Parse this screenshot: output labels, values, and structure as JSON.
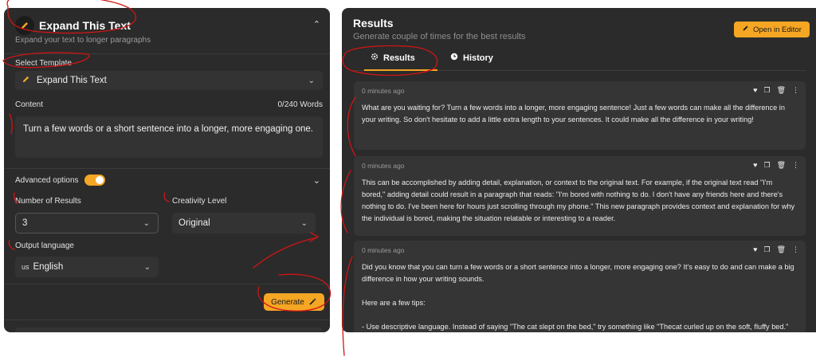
{
  "left": {
    "title": "Expand This Text",
    "subtitle": "Expand your text to longer paragraphs",
    "template_label": "Select Template",
    "template_value": "Expand This Text",
    "content_label": "Content",
    "word_count": "0/240 Words",
    "content_value": "Turn a few words or a short sentence into a longer, more engaging one.",
    "advanced_label": "Advanced options",
    "results_label": "Number of Results",
    "results_value": "3",
    "creativity_label": "Creativity Level",
    "creativity_value": "Original",
    "language_label": "Output language",
    "language_flag": "us",
    "language_value": "English",
    "generate_label": "Generate"
  },
  "right": {
    "title": "Results",
    "subtitle": "Generate couple of times for the best results",
    "open_editor_label": "Open in Editor",
    "tabs": [
      {
        "label": "Results",
        "active": true
      },
      {
        "label": "History",
        "active": false
      }
    ],
    "results": [
      {
        "time": "0 minutes ago",
        "text": "What are you waiting for? Turn a few words into a longer, more engaging sentence! Just a few words can make all the difference in your writing. So don't hesitate to add a little extra length to your sentences. It could make all the difference in your writing!"
      },
      {
        "time": "0 minutes ago",
        "text": "This can be accomplished by adding detail, explanation, or context to the original text. For example, if the original text read \"I'm bored,\" adding detail could result in a paragraph that reads: \"I'm bored with nothing to do. I don't have any friends here and there's nothing to do. I've been here for hours just scrolling through my phone.\" This new paragraph provides context and explanation for why the individual is bored, making the situation relatable or interesting to a reader."
      },
      {
        "time": "0 minutes ago",
        "paragraphs": [
          "Did you know that you can turn a few words or a short sentence into a longer, more engaging one? It's easy to do and can make a big difference in how your writing sounds.",
          "Here are a few tips:",
          "- Use descriptive language. Instead of saying \"The cat slept on the bed,\" try something like \"Thecat curled up on the soft, fluffy bed.\""
        ]
      }
    ]
  },
  "colors": {
    "accent": "#f5a623",
    "panel": "#2b2b2b",
    "card": "#353535",
    "annotation": "#d21414"
  },
  "icons": [
    "pencil-icon",
    "chevron-up-icon",
    "chevron-down-icon",
    "magic-wand-icon",
    "gear-icon",
    "history-clock-icon",
    "heart-icon",
    "copy-icon",
    "trash-icon",
    "more-vertical-icon"
  ]
}
